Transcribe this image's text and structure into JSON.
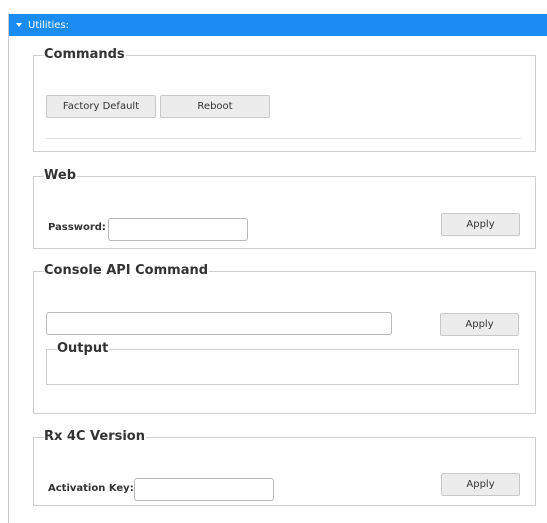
{
  "header": {
    "title": "Utilities:"
  },
  "commands": {
    "legend": "Commands",
    "factory_default_label": "Factory Default",
    "reboot_label": "Reboot"
  },
  "web": {
    "legend": "Web",
    "password_label": "Password:",
    "password_value": "",
    "apply_label": "Apply"
  },
  "console": {
    "legend": "Console API Command",
    "command_value": "",
    "apply_label": "Apply",
    "output_legend": "Output",
    "output_text": ""
  },
  "version": {
    "legend": "Rx 4C Version",
    "activation_label": "Activation Key:",
    "activation_value": "",
    "apply_label": "Apply"
  }
}
